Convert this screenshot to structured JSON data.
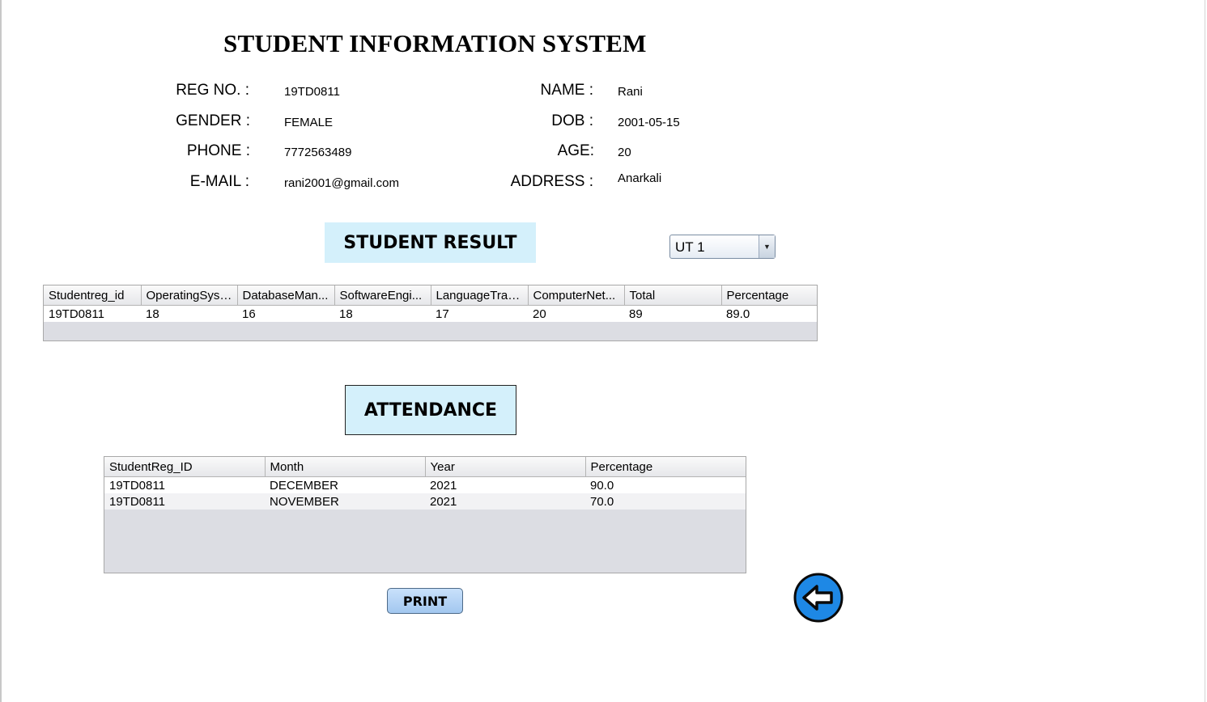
{
  "title": "STUDENT INFORMATION SYSTEM",
  "profile": {
    "reg_label": "REG NO. :",
    "reg_value": "19TD0811",
    "name_label": "NAME :",
    "name_value": "Rani",
    "gender_label": "GENDER :",
    "gender_value": "FEMALE",
    "dob_label": "DOB :",
    "dob_value": "2001-05-15",
    "phone_label": "PHONE :",
    "phone_value": "7772563489",
    "age_label": "AGE:",
    "age_value": "20",
    "email_label": "E-MAIL :",
    "email_value": "rani2001@gmail.com",
    "address_label": "ADDRESS :",
    "address_value": "Anarkali"
  },
  "result": {
    "heading": "STUDENT RESULT",
    "test_select": {
      "selected": "UT 1"
    },
    "columns": [
      "Studentreg_id",
      "OperatingSyst...",
      "DatabaseMan...",
      "SoftwareEngi...",
      "LanguageTran...",
      "ComputerNet...",
      "Total",
      "Percentage"
    ],
    "rows": [
      [
        "19TD0811",
        "18",
        "16",
        "18",
        "17",
        "20",
        "89",
        "89.0"
      ]
    ]
  },
  "attendance": {
    "heading": "ATTENDANCE",
    "columns": [
      "StudentReg_ID",
      "Month",
      "Year",
      "Percentage"
    ],
    "rows": [
      [
        "19TD0811",
        "DECEMBER",
        "2021",
        "90.0"
      ],
      [
        "19TD0811",
        "NOVEMBER",
        "2021",
        "70.0"
      ]
    ]
  },
  "actions": {
    "print_label": "PRINT",
    "back_icon": "back-arrow-icon",
    "back_color": "#1e88e5"
  }
}
